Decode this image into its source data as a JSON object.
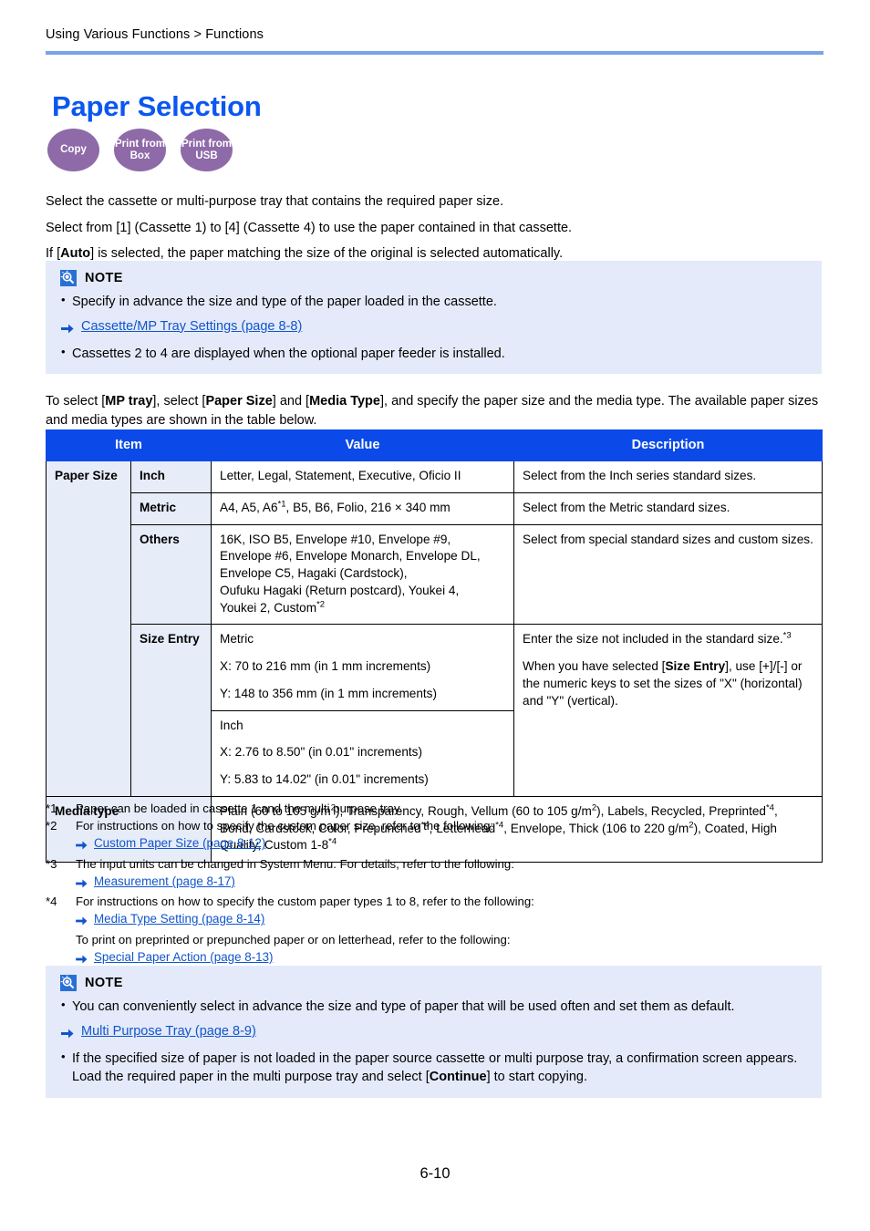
{
  "header": {
    "breadcrumb": "Using Various Functions > Functions",
    "title": "Paper Selection"
  },
  "badges": [
    {
      "name": "copy",
      "line1": "Copy",
      "line2": ""
    },
    {
      "name": "print-from-box",
      "line1": "Print from",
      "line2": "Box"
    },
    {
      "name": "print-from-usb",
      "line1": "Print from",
      "line2": "USB"
    }
  ],
  "intro": {
    "p1": "Select the cassette or multi-purpose tray that contains the required paper size.",
    "p2": "Select from [1] (Cassette 1) to [4] (Cassette 4) to use the paper contained in that cassette.",
    "p3_pre": "If [",
    "p3_bold": "Auto",
    "p3_post": "] is selected, the paper matching the size of the original is selected automatically."
  },
  "note_top": {
    "title": "NOTE",
    "item1": "Specify in advance the size and type of the paper loaded in the cassette.",
    "link1": "Cassette/MP Tray Settings (page 8-8)",
    "item2": "Cassettes 2 to 4 are displayed when the optional paper feeder is installed."
  },
  "table_intro": {
    "t1": "To select [",
    "b1": "MP tray",
    "t2": "], select [",
    "b2": "Paper Size",
    "t3": "] and [",
    "b3": "Media Type",
    "t4": "], and specify the paper size and the media type. The available paper sizes and media types are shown in the table below."
  },
  "table": {
    "headers": {
      "item": "Item",
      "value": "Value",
      "description": "Description"
    },
    "paper_size_label": "Paper Size",
    "rows": {
      "inch": {
        "label": "Inch",
        "value": "Letter, Legal, Statement, Executive, Oficio II",
        "description": "Select from the Inch series standard sizes."
      },
      "metric": {
        "label": "Metric",
        "value_a": "A4, A5, A6",
        "value_sup": "*1",
        "value_b": ", B5, B6, Folio, 216 × 340 mm",
        "description": "Select from the Metric standard sizes."
      },
      "others": {
        "label": "Others",
        "value_lines": [
          "16K, ISO B5, Envelope #10, Envelope #9,",
          "Envelope #6, Envelope Monarch, Envelope DL,",
          "Envelope C5, Hagaki (Cardstock),",
          "Oufuku Hagaki (Return postcard), Youkei 4,",
          "Youkei 2, Custom"
        ],
        "value_sup": "*2",
        "description": "Select from special standard sizes and custom sizes."
      },
      "size_entry": {
        "label": "Size Entry",
        "metric_title": "Metric",
        "metric_x": "X: 70 to 216 mm (in 1 mm increments)",
        "metric_y": "Y: 148 to 356 mm (in 1 mm increments)",
        "inch_title": "Inch",
        "inch_x": "X: 2.76 to 8.50\" (in 0.01\" increments)",
        "inch_y": "Y: 5.83 to 14.02\" (in 0.01\" increments)",
        "desc_p1": "Enter the size not included in the standard size.",
        "desc_p1_sup": "*3",
        "desc_p2_a": "When you have selected [",
        "desc_p2_bold": "Size Entry",
        "desc_p2_b": "], use [+]/[-] or the numeric keys to set the sizes of \"X\" (horizontal) and \"Y\" (vertical)."
      },
      "media_type": {
        "label": "Media type",
        "seg1": "Plain (60 to 105 g/m",
        "sup_a": "2",
        "seg2": "), Transparency, Rough, Vellum (60 to 105 g/m",
        "sup_b": "2",
        "seg3": "), Labels, Recycled, Preprinted",
        "sup_c": "*4",
        "seg4": ", Bond, Cardstock, Color, Prepunched",
        "sup_d": "*4",
        "seg5": ", Letterhead",
        "sup_e": "*4",
        "seg6": ", Envelope, Thick (106 to 220 g/m",
        "sup_f": "2",
        "seg7": "), Coated, High Quality, Custom 1-8",
        "sup_g": "*4"
      }
    }
  },
  "footnotes": [
    {
      "mark": "*1",
      "text": "Paper can be loaded in cassette 1 and the multi purpose tray."
    },
    {
      "mark": "*2",
      "text": "For instructions on how to specify the custom paper size, refer to the following:",
      "link": "Custom Paper Size (page 8-12)"
    },
    {
      "mark": "*3",
      "text": "The input units can be changed in System Menu. For details, refer to the following:",
      "link": "Measurement (page 8-17)"
    },
    {
      "mark": "*4",
      "text": "For instructions on how to specify the custom paper types 1 to 8, refer to the following:",
      "link": "Media Type Setting (page 8-14)",
      "sub_text": "To print on preprinted or prepunched paper or on letterhead, refer to the following:",
      "sub_link": "Special Paper Action (page 8-13)"
    }
  ],
  "note_bottom": {
    "title": "NOTE",
    "item1": "You can conveniently select in advance the size and type of paper that will be used often and set them as default.",
    "link1": "Multi Purpose Tray (page 8-9)",
    "item2_a": "If the specified size of paper is not loaded in the paper source cassette or multi purpose tray, a confirmation screen appears. Load the required paper in the multi purpose tray and select [",
    "item2_bold": "Continue",
    "item2_b": "] to start copying."
  },
  "footer": {
    "page_number": "6-10"
  },
  "colors": {
    "title_blue": "#0b57f0",
    "rule_blue": "#7ba3e8",
    "table_header_blue": "#0b4ae8",
    "badge_purple": "#8e6aa8",
    "note_bg": "#e4eaf9",
    "cell_shade": "#e6ecf8",
    "link_blue": "#1155cc"
  }
}
